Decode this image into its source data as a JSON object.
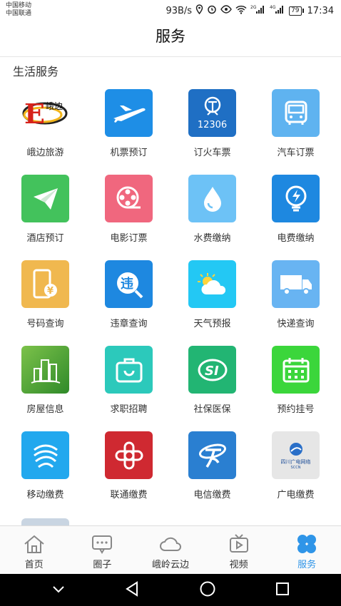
{
  "status_bar": {
    "carrier1": "中国移动",
    "carrier2": "中国联通",
    "speed": "93B/s",
    "net1": "2G",
    "net2": "4G",
    "battery": "79",
    "time": "17:34"
  },
  "header": {
    "title": "服务"
  },
  "section": {
    "title": "生活服务"
  },
  "services": [
    {
      "label": "峨边旅游",
      "icon": "ebian-tour-logo-icon",
      "text": "峨边"
    },
    {
      "label": "机票预订",
      "icon": "airplane-icon",
      "color": "#1e8ee6"
    },
    {
      "label": "订火车票",
      "icon": "railway-12306-icon",
      "color": "#1f6fc4",
      "text": "12306"
    },
    {
      "label": "汽车订票",
      "icon": "bus-icon",
      "color": "#5fb3f0"
    },
    {
      "label": "酒店预订",
      "icon": "paper-plane-icon",
      "color": "#43c25c"
    },
    {
      "label": "电影订票",
      "icon": "film-reel-icon",
      "color": "#f0677e"
    },
    {
      "label": "水费缴纳",
      "icon": "water-drop-icon",
      "color": "#6dc2f6"
    },
    {
      "label": "电费缴纳",
      "icon": "lightning-bulb-icon",
      "color": "#1e88e0"
    },
    {
      "label": "号码查询",
      "icon": "phone-yuan-icon",
      "color": "#f0b84f",
      "text": "¥"
    },
    {
      "label": "违章查询",
      "icon": "violation-search-icon",
      "color": "#1e88e0",
      "text": "违"
    },
    {
      "label": "天气预报",
      "icon": "weather-sun-cloud-icon",
      "color": "#23c8f4"
    },
    {
      "label": "快递查询",
      "icon": "delivery-truck-icon",
      "color": "#68b4f2"
    },
    {
      "label": "房屋信息",
      "icon": "buildings-icon",
      "color": "#3a9a32"
    },
    {
      "label": "求职招聘",
      "icon": "briefcase-icon",
      "color": "#2cc9bb"
    },
    {
      "label": "社保医保",
      "icon": "social-security-icon",
      "color": "#22b573",
      "text": "SI"
    },
    {
      "label": "预约挂号",
      "icon": "calendar-icon",
      "color": "#3bd63b"
    },
    {
      "label": "移动缴费",
      "icon": "china-mobile-icon",
      "color": "#22a8ee"
    },
    {
      "label": "联通缴费",
      "icon": "china-unicom-knot-icon",
      "color": "#cf2931"
    },
    {
      "label": "电信缴费",
      "icon": "china-telecom-icon",
      "color": "#2a7fd1"
    },
    {
      "label": "广电缴费",
      "icon": "sichuan-broadcast-icon",
      "color": "#e6e6e6",
      "text": "四川广电网络",
      "text2": "SCCN"
    }
  ],
  "tabs": [
    {
      "label": "首页",
      "icon": "home-icon"
    },
    {
      "label": "圈子",
      "icon": "chat-bubble-icon"
    },
    {
      "label": "峨岭云边",
      "icon": "cloud-icon"
    },
    {
      "label": "视频",
      "icon": "tv-play-icon"
    },
    {
      "label": "服务",
      "icon": "clover-grid-icon",
      "active": true
    }
  ],
  "colors": {
    "accent": "#2f95e8"
  }
}
